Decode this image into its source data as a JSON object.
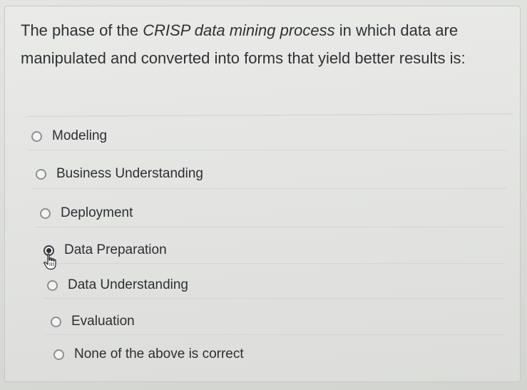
{
  "question": {
    "prefix": "The phase of the ",
    "emphasis": "CRISP data mining process",
    "suffix": " in which data are manipulated and converted into forms that yield better results is:"
  },
  "options": [
    {
      "label": "Modeling",
      "selected": false
    },
    {
      "label": "Business Understanding",
      "selected": false
    },
    {
      "label": "Deployment",
      "selected": false
    },
    {
      "label": "Data Preparation",
      "selected": true
    },
    {
      "label": "Data Understanding",
      "selected": false
    },
    {
      "label": "Evaluation",
      "selected": false
    },
    {
      "label": "None of the above is correct",
      "selected": false
    }
  ],
  "colors": {
    "text": "#2c2f33",
    "radio_border": "#8c9095",
    "radio_selected": "#2d3137"
  },
  "icons": {
    "cursor": "hand-pointer-icon"
  }
}
